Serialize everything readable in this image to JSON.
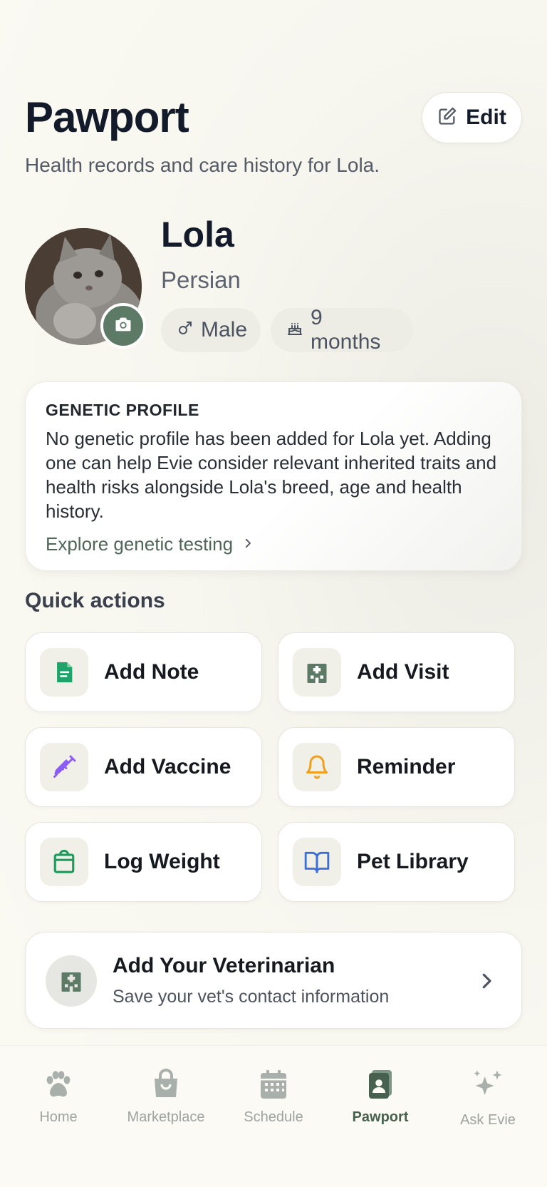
{
  "header": {
    "title": "Pawport",
    "subtitle": "Health records and care history for Lola.",
    "edit_label": "Edit"
  },
  "pet": {
    "name": "Lola",
    "breed": "Persian",
    "sex": "Male",
    "age": "9 months"
  },
  "genetic_profile": {
    "heading": "GENETIC PROFILE",
    "body": "No genetic profile has been added for Lola yet. Adding one can help Evie consider relevant inherited traits and health risks alongside Lola's breed, age and health history.",
    "link": "Explore genetic testing"
  },
  "quick_actions": {
    "title": "Quick actions",
    "items": [
      {
        "label": "Add Note",
        "icon": "note-icon",
        "color": "#1fa36a"
      },
      {
        "label": "Add Visit",
        "icon": "hospital-icon",
        "color": "#5d7a66"
      },
      {
        "label": "Add Vaccine",
        "icon": "syringe-icon",
        "color": "#8b5cf6"
      },
      {
        "label": "Reminder",
        "icon": "bell-icon",
        "color": "#f0a020"
      },
      {
        "label": "Log Weight",
        "icon": "weight-icon",
        "color": "#1f9a5c"
      },
      {
        "label": "Pet Library",
        "icon": "book-icon",
        "color": "#3b6fd6"
      }
    ]
  },
  "vet": {
    "title": "Add Your Veterinarian",
    "subtitle": "Save your vet's contact information"
  },
  "nav": {
    "items": [
      {
        "label": "Home",
        "icon": "paw-icon"
      },
      {
        "label": "Marketplace",
        "icon": "shopping-bag-icon"
      },
      {
        "label": "Schedule",
        "icon": "calendar-icon"
      },
      {
        "label": "Pawport",
        "icon": "pawport-icon",
        "active": true
      },
      {
        "label": "Ask Evie",
        "icon": "sparkles-icon"
      }
    ]
  }
}
